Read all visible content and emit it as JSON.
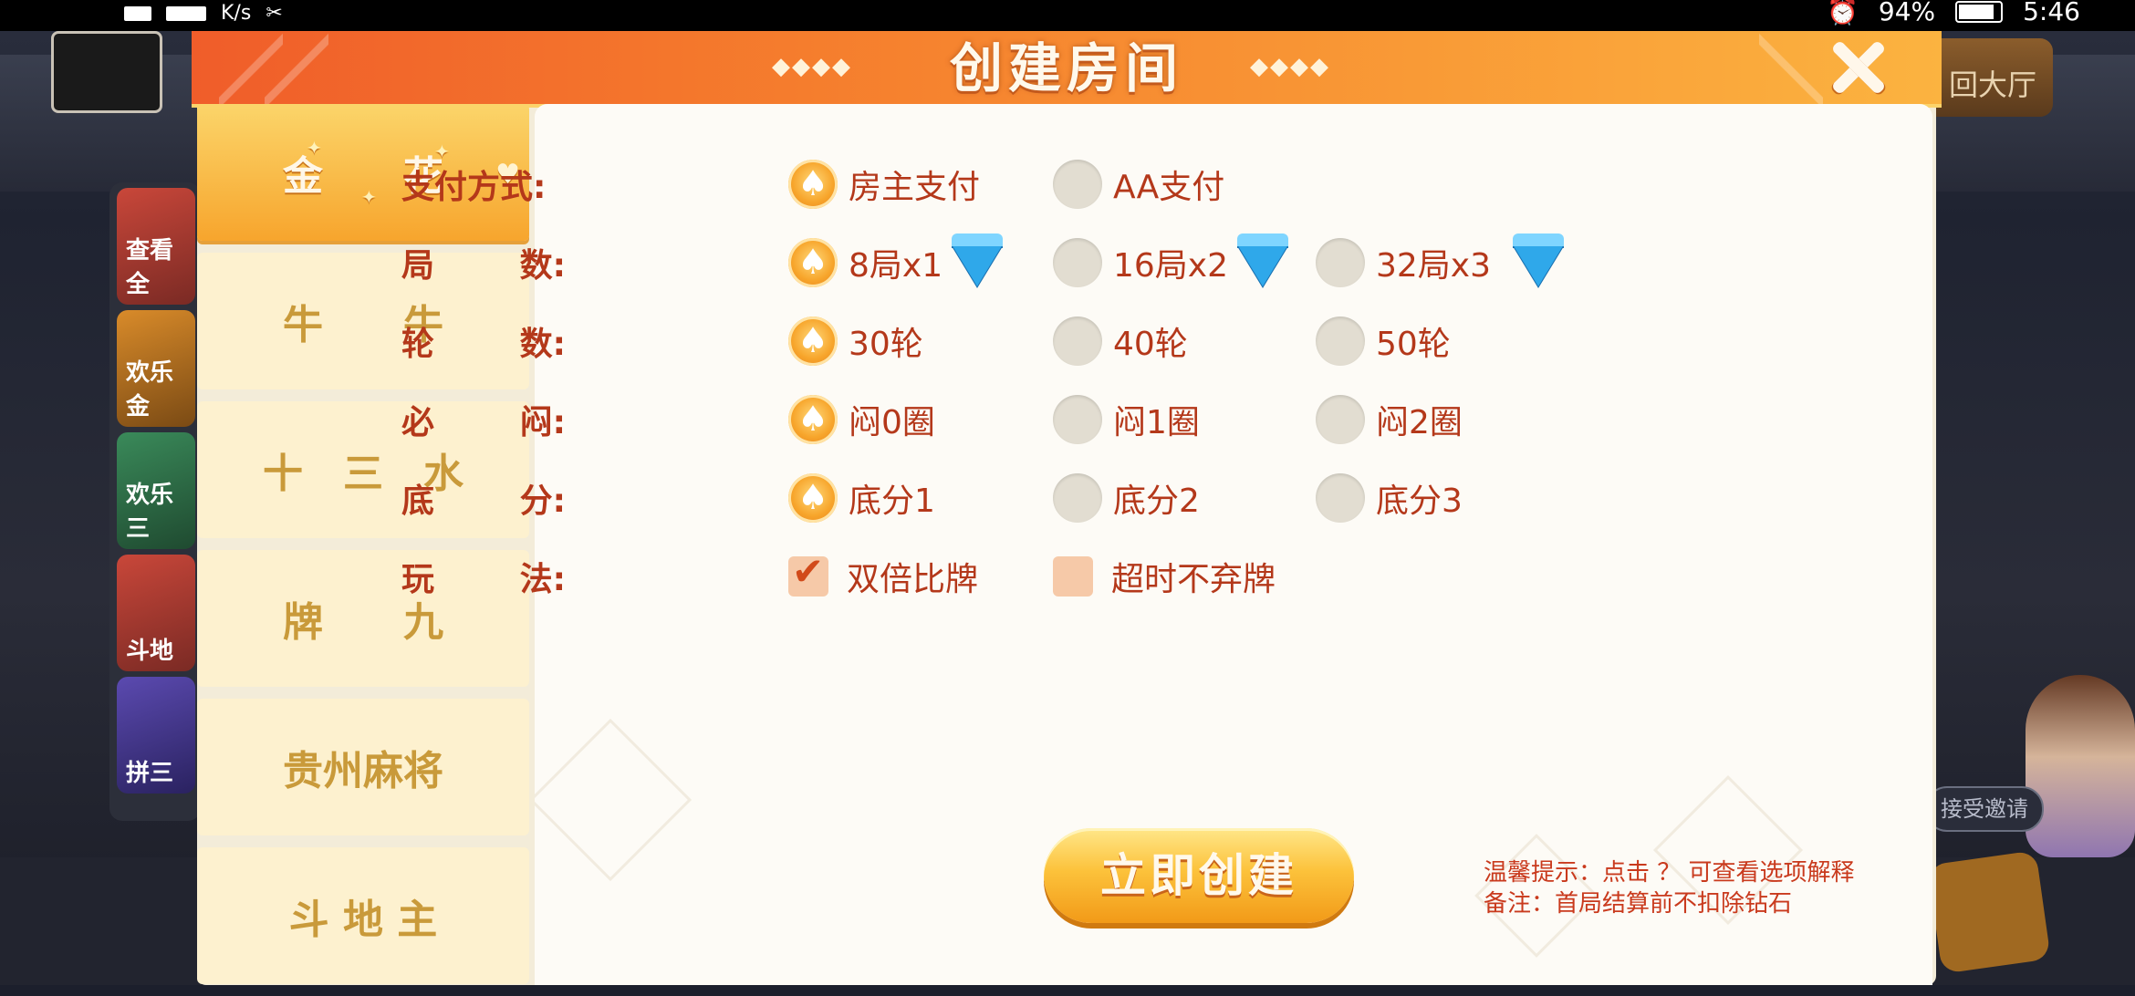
{
  "status_bar": {
    "net_speed": "K/s",
    "battery": "94%",
    "time": "5:46"
  },
  "background": {
    "thumbs": [
      "查看全",
      "欢乐金",
      "欢乐三",
      "斗地",
      "拼三"
    ],
    "right_button": "回大厅",
    "invite": "接受邀请"
  },
  "dialog": {
    "title": "创建房间",
    "title_deco_left": "◆◆◆◆",
    "title_deco_right": "◆◆◆◆"
  },
  "sidebar": {
    "tabs": [
      {
        "label": "金　　花"
      },
      {
        "label": "牛　　牛"
      },
      {
        "label": "十　三　水"
      },
      {
        "label": "牌　　九"
      },
      {
        "label": "贵州麻将"
      },
      {
        "label": "斗 地 主"
      }
    ]
  },
  "options": {
    "payment": {
      "label": "支付方式:",
      "choices": [
        "房主支付",
        "AA支付"
      ],
      "selected": 0
    },
    "rounds": {
      "label_a": "局",
      "label_b": "数:",
      "choices": [
        "8局x1",
        "16局x2",
        "32局x3"
      ],
      "selected": 0
    },
    "turns": {
      "label_a": "轮",
      "label_b": "数:",
      "choices": [
        "30轮",
        "40轮",
        "50轮"
      ],
      "selected": 0
    },
    "must_blind": {
      "label_a": "必",
      "label_b": "闷:",
      "choices": [
        "闷0圈",
        "闷1圈",
        "闷2圈"
      ],
      "selected": 0
    },
    "base_score": {
      "label_a": "底",
      "label_b": "分:",
      "choices": [
        "底分1",
        "底分2",
        "底分3"
      ],
      "selected": 0
    },
    "play_rules": {
      "label_a": "玩",
      "label_b": "法:",
      "choices": [
        "双倍比牌",
        "超时不弃牌"
      ],
      "checked": [
        true,
        false
      ]
    }
  },
  "create_button": "立即创建",
  "tips": {
    "line1": "温馨提示：点击 ？ 可查看选项解释",
    "line2": "备注：首局结算前不扣除钻石"
  },
  "colors": {
    "accent": "#f7a52d",
    "label_red": "#b4381a",
    "diamond_blue": "#2fa8ea"
  }
}
